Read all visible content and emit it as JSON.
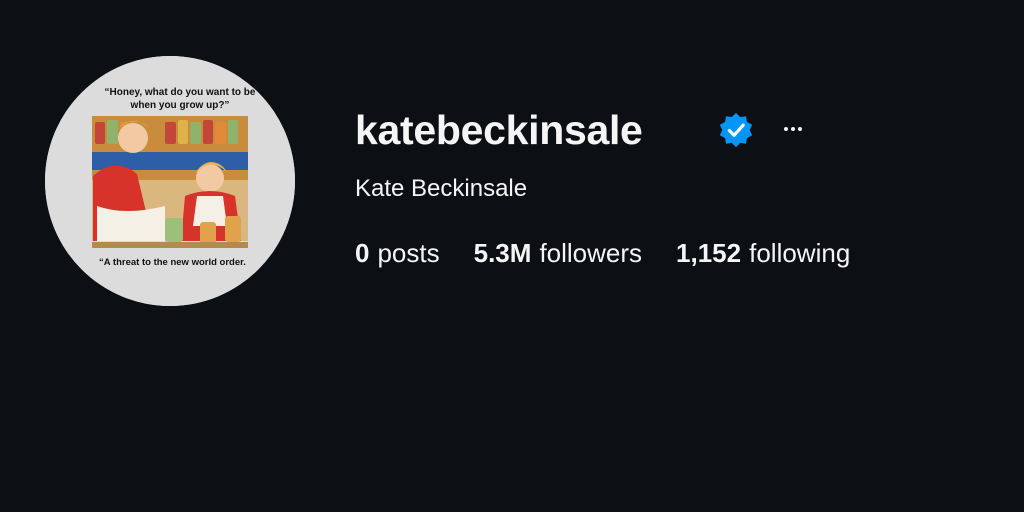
{
  "profile": {
    "username": "katebeckinsale",
    "full_name": "Kate Beckinsale",
    "verified": true,
    "verified_color": "#0095f6",
    "avatar": {
      "caption_top": "“Honey, what do you want to be when you grow up?”",
      "caption_bottom": "“A threat to the new world order.",
      "background_color": "#dcdcdc"
    },
    "more_icon": "more-horizontal-icon",
    "stats": [
      {
        "value": "0",
        "label": "posts"
      },
      {
        "value": "5.3M",
        "label": "followers"
      },
      {
        "value": "1,152",
        "label": "following"
      }
    ]
  },
  "colors": {
    "background": "#0c0f14",
    "text": "#f5f5f5"
  }
}
